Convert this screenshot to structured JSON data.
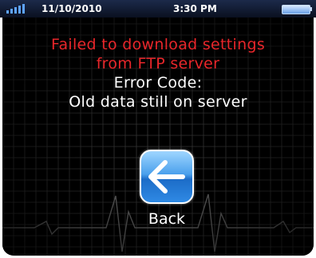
{
  "status_bar": {
    "signal_icon": "signal-bars-icon",
    "date": "11/10/2010",
    "time": "3:30 PM",
    "battery_icon": "battery-icon"
  },
  "error_dialog": {
    "message_line1": "Failed to download settings",
    "message_line2": "from FTP server",
    "error_code_label": "Error Code:",
    "error_code_value": "Old data still on server"
  },
  "back_button": {
    "label": "Back",
    "icon": "back-arrow-icon"
  },
  "colors": {
    "error_text": "#e8262a",
    "info_text": "#ffffff",
    "grid": "#3a3a3a",
    "button": "#2f8ae4"
  }
}
